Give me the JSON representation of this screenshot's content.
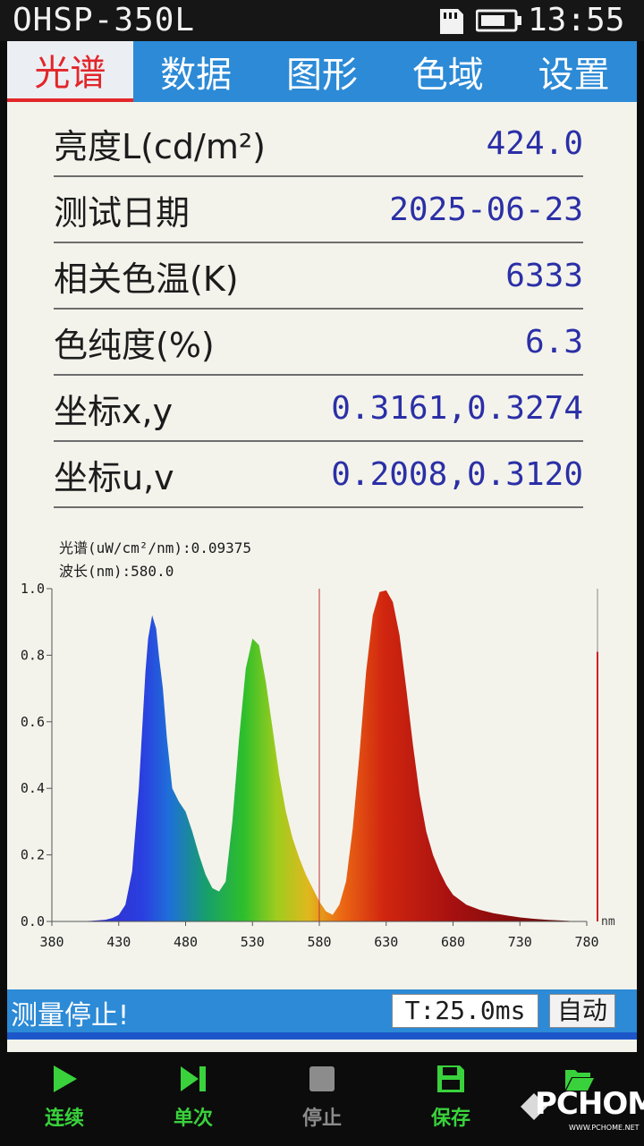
{
  "status_bar": {
    "device_name": "OHSP-350L",
    "time": "13:55"
  },
  "tabs": [
    {
      "label": "光谱",
      "active": true
    },
    {
      "label": "数据",
      "active": false
    },
    {
      "label": "图形",
      "active": false
    },
    {
      "label": "色域",
      "active": false
    },
    {
      "label": "设置",
      "active": false
    }
  ],
  "measurements": [
    {
      "label": "亮度L(cd/m²)",
      "value": "424.0"
    },
    {
      "label": "测试日期",
      "value": "2025-06-23"
    },
    {
      "label": "相关色温(K)",
      "value": "6333"
    },
    {
      "label": "色纯度(%)",
      "value": "6.3"
    },
    {
      "label": "坐标x,y",
      "value": "0.3161,0.3274"
    },
    {
      "label": "坐标u,v",
      "value": "0.2008,0.3120"
    }
  ],
  "chart_data": {
    "type": "area",
    "readout_line1": "光谱(uW/cm²/nm):0.09375",
    "readout_line2": "波长(nm):580.0",
    "x_unit": "nm",
    "xlim": [
      380,
      780
    ],
    "ylim": [
      0,
      1.0
    ],
    "x_ticks": [
      380,
      430,
      480,
      530,
      580,
      630,
      680,
      730,
      780
    ],
    "y_ticks": [
      "0.0",
      "0.2",
      "0.4",
      "0.6",
      "0.8",
      "1.0"
    ],
    "cursor_wavelength": 580.0,
    "cursor_intensity": 0.09375,
    "series": [
      {
        "x": [
          380,
          400,
          410,
          420,
          425,
          430,
          435,
          440,
          445,
          450,
          452,
          455,
          458,
          460,
          463,
          466,
          470,
          475,
          480,
          485,
          490,
          495,
          500,
          505,
          510,
          515,
          520,
          525,
          530,
          535,
          540,
          545,
          550,
          555,
          560,
          565,
          570,
          575,
          580,
          585,
          590,
          595,
          600,
          605,
          610,
          615,
          620,
          625,
          630,
          635,
          640,
          645,
          650,
          655,
          660,
          665,
          670,
          675,
          680,
          690,
          700,
          710,
          720,
          730,
          740,
          750,
          760,
          770,
          780
        ],
        "y": [
          0,
          0,
          0.002,
          0.005,
          0.01,
          0.02,
          0.05,
          0.15,
          0.4,
          0.75,
          0.85,
          0.92,
          0.88,
          0.8,
          0.7,
          0.55,
          0.4,
          0.36,
          0.33,
          0.27,
          0.2,
          0.14,
          0.1,
          0.09,
          0.12,
          0.3,
          0.55,
          0.76,
          0.85,
          0.83,
          0.72,
          0.58,
          0.44,
          0.33,
          0.25,
          0.19,
          0.14,
          0.1,
          0.06,
          0.03,
          0.02,
          0.05,
          0.12,
          0.28,
          0.5,
          0.75,
          0.92,
          0.99,
          0.995,
          0.96,
          0.86,
          0.7,
          0.53,
          0.38,
          0.27,
          0.2,
          0.15,
          0.11,
          0.08,
          0.05,
          0.035,
          0.025,
          0.018,
          0.012,
          0.008,
          0.005,
          0.003,
          0.001,
          0
        ]
      }
    ]
  },
  "status_strip": {
    "message": "测量停止!",
    "integration_time": "T:25.0ms",
    "auto_label": "自动"
  },
  "toolbar": [
    {
      "label": "连续",
      "icon": "play-icon",
      "enabled": true
    },
    {
      "label": "单次",
      "icon": "step-icon",
      "enabled": true
    },
    {
      "label": "停止",
      "icon": "stop-icon",
      "enabled": false
    },
    {
      "label": "保存",
      "icon": "save-icon",
      "enabled": true
    },
    {
      "label": "",
      "icon": "folder-open-icon",
      "enabled": true
    }
  ],
  "watermark": {
    "brand": "PCHOME",
    "url": "WWW.PCHOME.NET"
  },
  "colors": {
    "tab_bar": "#2c8ad6",
    "active_tab": "#e2262a",
    "value_text": "#2b2fa6",
    "toolbar_label": "#39d23c"
  }
}
